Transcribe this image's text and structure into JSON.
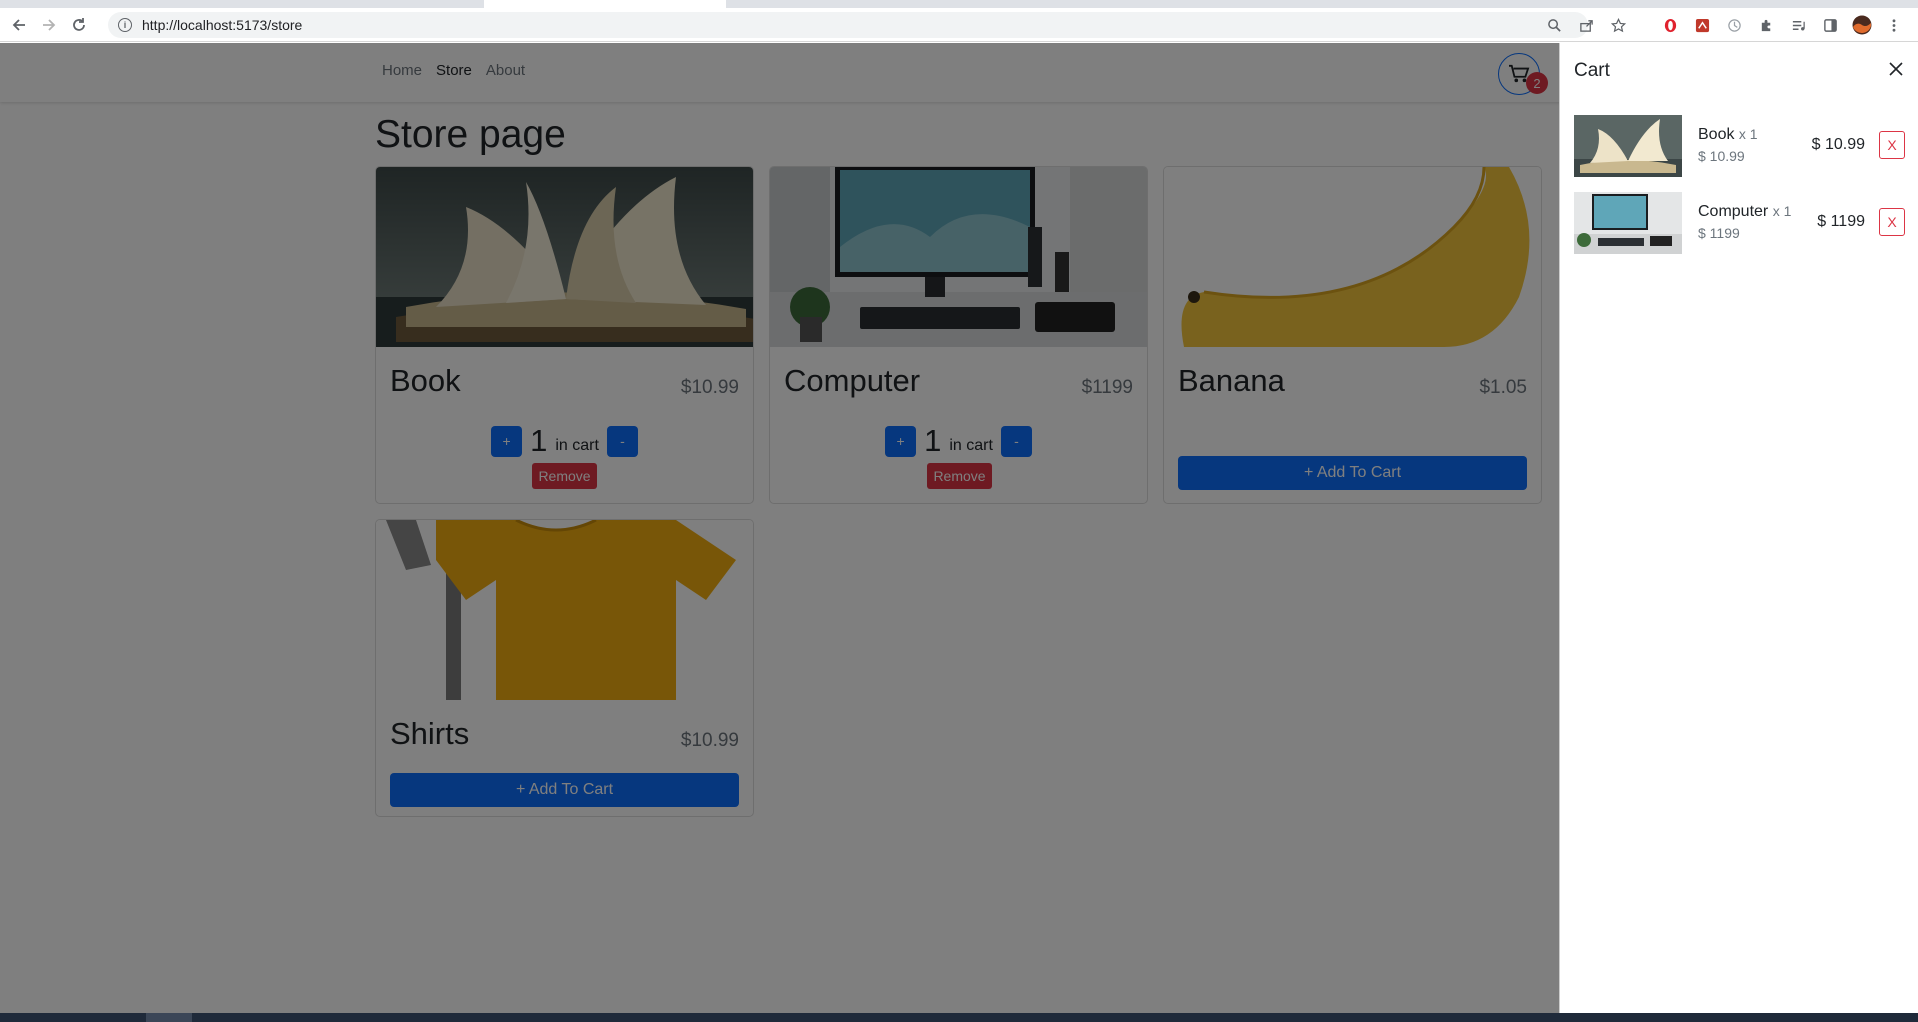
{
  "browser": {
    "url": "http://localhost:5173/store",
    "back_icon": "arrow-left-icon",
    "forward_icon": "arrow-right-icon",
    "reload_icon": "reload-icon"
  },
  "navbar": {
    "links": [
      {
        "label": "Home",
        "active": false
      },
      {
        "label": "Store",
        "active": true
      },
      {
        "label": "About",
        "active": false
      }
    ],
    "cart_count": "2"
  },
  "page": {
    "title": "Store page"
  },
  "products": [
    {
      "name": "Book",
      "price": "$10.99",
      "quantity": "1",
      "in_cart_label": "in cart",
      "plus_label": "+",
      "minus_label": "-",
      "remove_label": "Remove"
    },
    {
      "name": "Computer",
      "price": "$1199",
      "quantity": "1",
      "in_cart_label": "in cart",
      "plus_label": "+",
      "minus_label": "-",
      "remove_label": "Remove"
    },
    {
      "name": "Banana",
      "price": "$1.05",
      "add_label": "+ Add To Cart"
    },
    {
      "name": "Shirts",
      "price": "$10.99",
      "add_label": "+ Add To Cart"
    }
  ],
  "cart": {
    "title": "Cart",
    "items": [
      {
        "name": "Book",
        "multiplier": "x 1",
        "unit_price": "$ 10.99",
        "total": "$ 10.99",
        "remove_label": "X"
      },
      {
        "name": "Computer",
        "multiplier": "x 1",
        "unit_price": "$ 1199",
        "total": "$ 1199",
        "remove_label": "X"
      }
    ]
  },
  "colors": {
    "primary": "#0d6efd",
    "danger": "#dc3545",
    "overlay": "rgba(0,0,0,0.5)"
  }
}
